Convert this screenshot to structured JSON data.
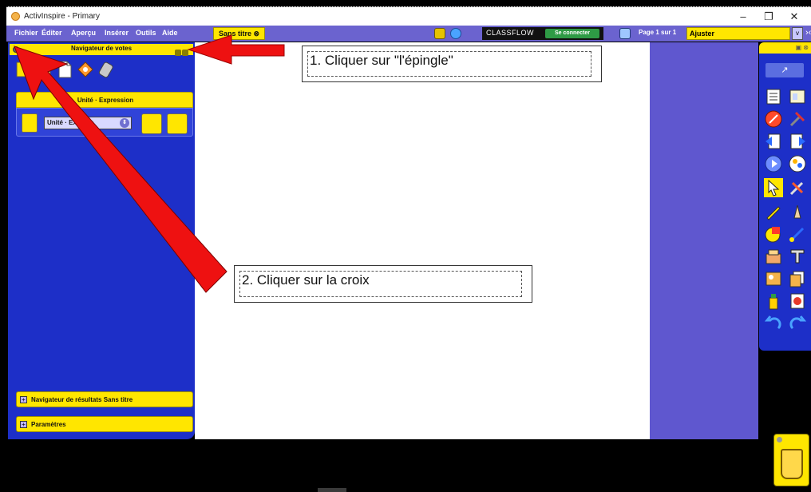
{
  "window": {
    "title": "ActivInspire - Primary",
    "controls": {
      "minimize": "–",
      "maximize": "❐",
      "close": "✕"
    }
  },
  "menubar": {
    "items": [
      "Fichier",
      "Éditer",
      "Aperçu",
      "Insérer",
      "Outils",
      "Aide"
    ],
    "doc_tab": "Sans titre ⊗",
    "classflow_label": "CLASSFLOW",
    "classflow_connect": "Se connecter",
    "page_label": "Page 1 sur 1",
    "zoom_value": "Ajuster",
    "zoom_arrow": "v",
    "collapse": "›‹"
  },
  "left_panel": {
    "title": "Navigateur de votes",
    "question_box_title": "Unité · Expression",
    "device_select": "Unité · Express",
    "device_select_arrow": "⇕",
    "results_label": "Navigateur de résultats Sans titre",
    "params_label": "Paramètres",
    "expand_symbol": "+"
  },
  "toolbox": {
    "share_glyph": "↗",
    "head_glyph": "▣ ⊗"
  },
  "annotations": {
    "step1": "1. Cliquer sur \"l'épingle\"",
    "step2": "2. Cliquer sur la croix"
  },
  "colors": {
    "panel_blue": "#1d2fc8",
    "menu_purple": "#6b63cf",
    "highlight_yellow": "#ffe600",
    "arrow_red": "#ee1111",
    "classflow_green": "#2e9b45"
  }
}
